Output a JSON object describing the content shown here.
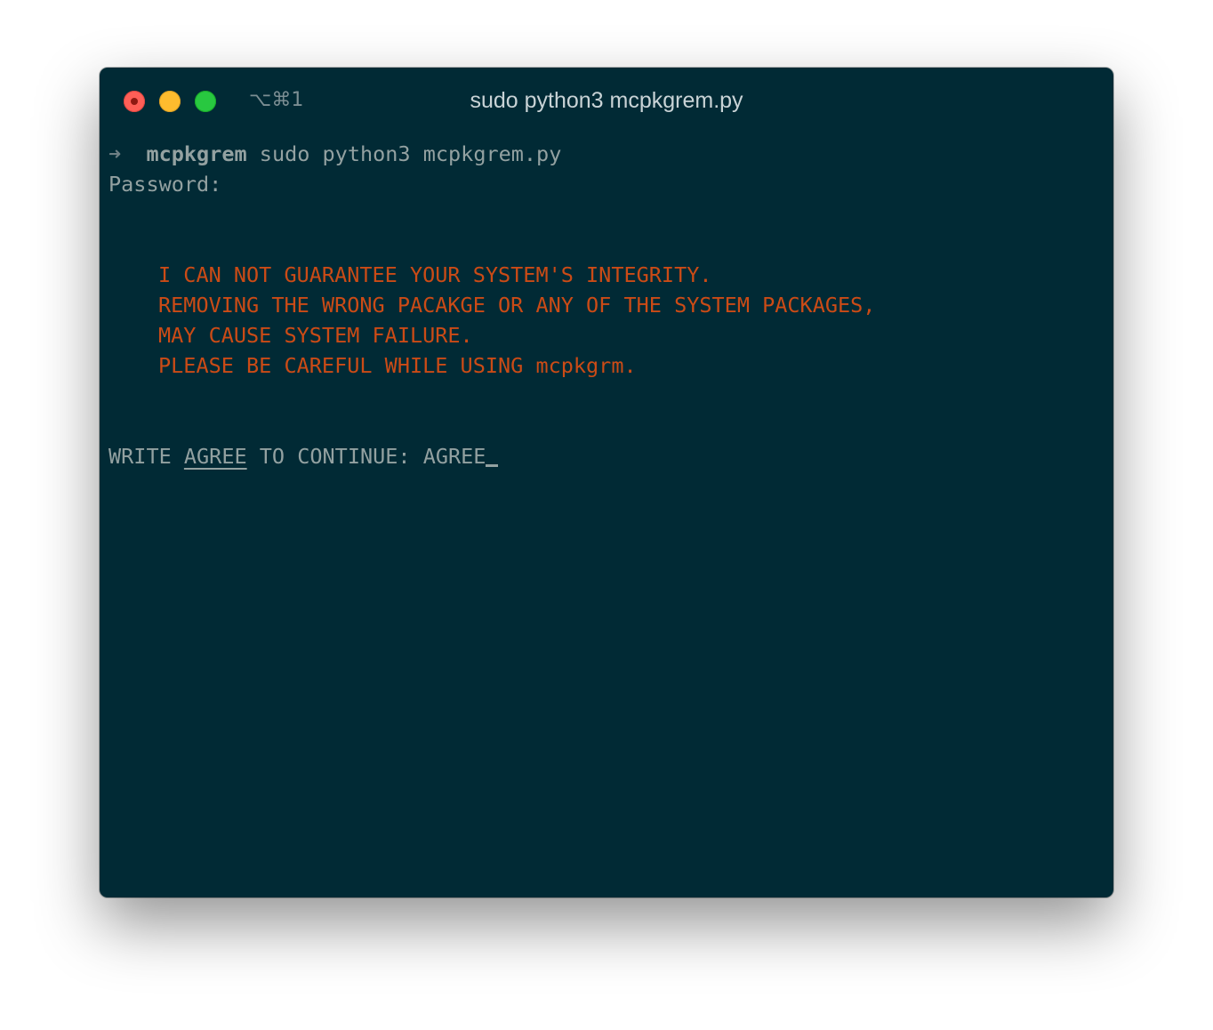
{
  "window": {
    "shortcut": "⌥⌘1",
    "title": "sudo python3 mcpkgrem.py"
  },
  "terminal": {
    "prompt": {
      "arrow": "➜",
      "cwd": "mcpkgrem",
      "command": "sudo python3 mcpkgrem.py"
    },
    "password_label": "Password:",
    "warning_lines": [
      "I CAN NOT GUARANTEE YOUR SYSTEM'S INTEGRITY.",
      "REMOVING THE WRONG PACAKGE OR ANY OF THE SYSTEM PACKAGES,",
      "MAY CAUSE SYSTEM FAILURE.",
      "PLEASE BE CAREFUL WHILE USING mcpkgrm."
    ],
    "confirm": {
      "before": "WRITE ",
      "keyword": "AGREE",
      "after": " TO CONTINUE: ",
      "input_value": "AGREE"
    }
  },
  "colors": {
    "background": "#012a35",
    "text": "#93a1a1",
    "warning": "#cb4b16"
  }
}
